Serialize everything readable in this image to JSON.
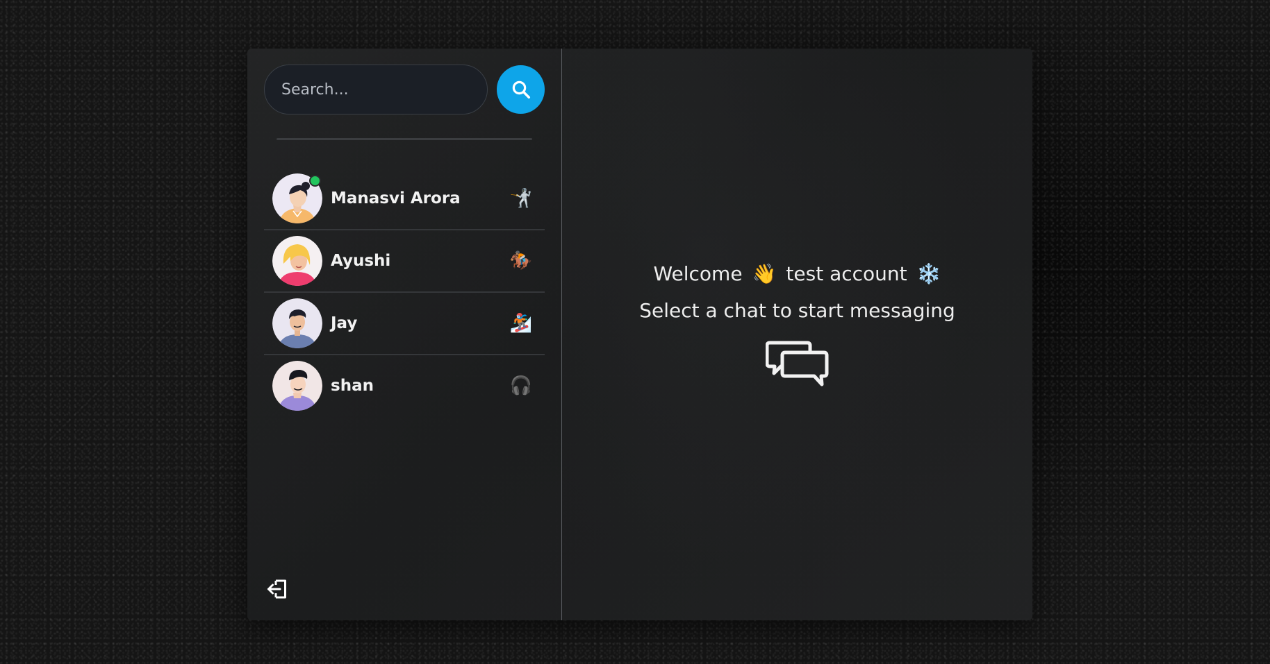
{
  "search": {
    "placeholder": "Search..."
  },
  "contacts": [
    {
      "name": "Manasvi Arora",
      "emoji": "🤺",
      "online": true
    },
    {
      "name": "Ayushi",
      "emoji": "🏇🏽",
      "online": false
    },
    {
      "name": "Jay",
      "emoji": "🏂🏽",
      "online": false
    },
    {
      "name": "shan",
      "emoji": "🎧",
      "online": false
    }
  ],
  "welcome": {
    "greeting": "Welcome",
    "wave_emoji": "👋",
    "username": "test account",
    "snow_emoji": "❄️",
    "prompt": "Select a chat to start messaging"
  },
  "icons": {
    "search": "search-icon",
    "logout": "logout-icon",
    "chat": "chat-bubbles-icon"
  },
  "colors": {
    "accent": "#0ea5e9",
    "online": "#22c55e"
  }
}
